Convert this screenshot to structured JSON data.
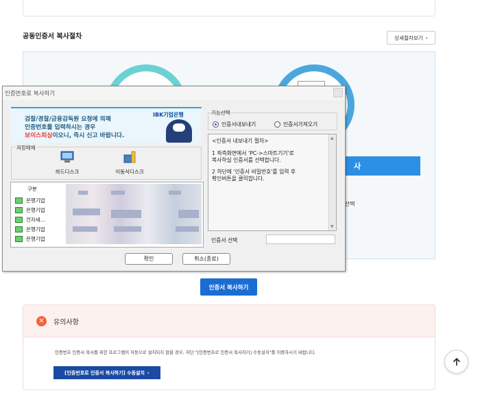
{
  "section": {
    "title": "공동인증서 복사절차",
    "detail_button": "상세절차보기",
    "step_bar": "사",
    "step_text": "]] 선택"
  },
  "cta": {
    "label": "인증서 복사하기"
  },
  "notice": {
    "icon": "x-icon",
    "title": "유의사항",
    "text": "인증번호 인증서 복사를 위한 프로그램이 자동으로 설치되지 않을 경우, 하단 \"[인증번호로 인증서 복사하기] 수동설치\"를 이용하시기 바랍니다.",
    "install_button": "[인증번호로 인증서 복사하기] 수동설치"
  },
  "dialog": {
    "title": "인증번호로 복사하기",
    "banner": {
      "line1": "검찰/경찰/금융감독원 요청에 의해",
      "line2": "인증번호를 입력하시는 경우",
      "line3_highlight": "보이스피싱",
      "line3_rest": "이오니, 즉시 신고 바랍니다.",
      "logo": "IBK기업은행"
    },
    "storage": {
      "label": "저장매체",
      "items": [
        {
          "label": "하드디스크",
          "icon": "hard-disk-icon"
        },
        {
          "label": "이동식디스크",
          "icon": "removable-disk-icon"
        }
      ]
    },
    "list": {
      "header": "구분",
      "rows": [
        "은행기업",
        "은행기업",
        "전자세...",
        "은행기업",
        "은행기업"
      ]
    },
    "function": {
      "label": "기능선택",
      "options": [
        "인증서내보내기",
        "인증서가져오기"
      ],
      "selected": "인증서내보내기"
    },
    "procedure": {
      "title": "<인증서 내보내기 절차>",
      "steps": [
        "1 좌측화면에서 'PC->스마트기기'로\n   복사하실 인증서를 선택합니다.",
        "2 하단에 '인증서 비밀번호'를 입력 후\n   확인버튼을 클릭합니다."
      ]
    },
    "cert_select_label": "인증서 선택",
    "ok_button": "확인",
    "cancel_button": "취소(종료)"
  },
  "colors": {
    "primary": "#1b6dd3",
    "warning": "#f2633f",
    "circle1": "#6bd1d3",
    "circle2": "#4aa7dd"
  }
}
